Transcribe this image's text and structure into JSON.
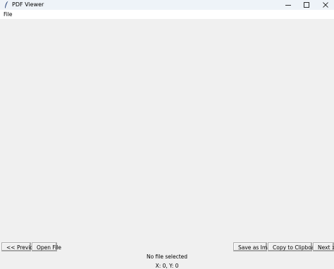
{
  "window": {
    "title": "PDF Viewer",
    "icon": "feather-icon",
    "controls": [
      "minimize-icon",
      "maximize-icon",
      "close-icon"
    ]
  },
  "menubar": {
    "file_label": "File"
  },
  "buttons": {
    "previous_label": "<< Previous",
    "open_label": "Open File",
    "save_label": "Save as Image",
    "copy_label": "Copy to Clipboard",
    "next_label": "Next >>"
  },
  "status": {
    "file_text": "No file selected",
    "coords_text": "X: 0, Y: 0"
  }
}
